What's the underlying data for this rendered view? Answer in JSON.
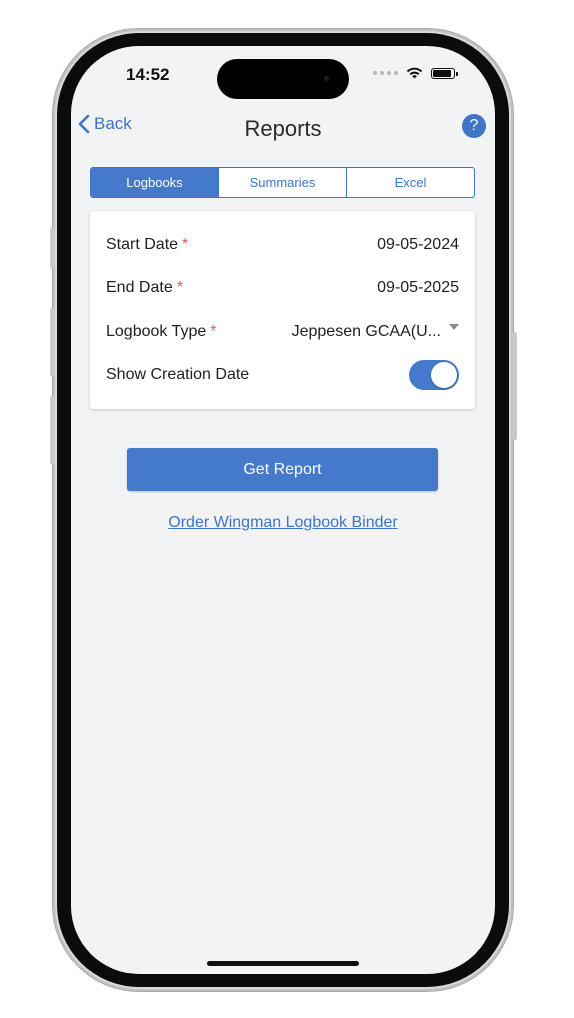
{
  "status_bar": {
    "time": "14:52"
  },
  "nav": {
    "back_label": "Back",
    "title": "Reports",
    "help_label": "?"
  },
  "tabs": [
    {
      "label": "Logbooks",
      "active": true
    },
    {
      "label": "Summaries",
      "active": false
    },
    {
      "label": "Excel",
      "active": false
    }
  ],
  "form": {
    "start_date": {
      "label": "Start Date",
      "required_mark": "*",
      "value": "09-05-2024"
    },
    "end_date": {
      "label": "End Date",
      "required_mark": "*",
      "value": "09-05-2025"
    },
    "logbook_type": {
      "label": "Logbook Type",
      "required_mark": "*",
      "value": "Jeppesen GCAA(U..."
    },
    "show_creation_date": {
      "label": "Show Creation Date",
      "enabled": true
    }
  },
  "actions": {
    "get_report_label": "Get Report",
    "order_binder_link": "Order Wingman Logbook Binder"
  },
  "colors": {
    "accent": "#4479cc",
    "required": "#e25a5a",
    "background": "#f2f3f5"
  }
}
